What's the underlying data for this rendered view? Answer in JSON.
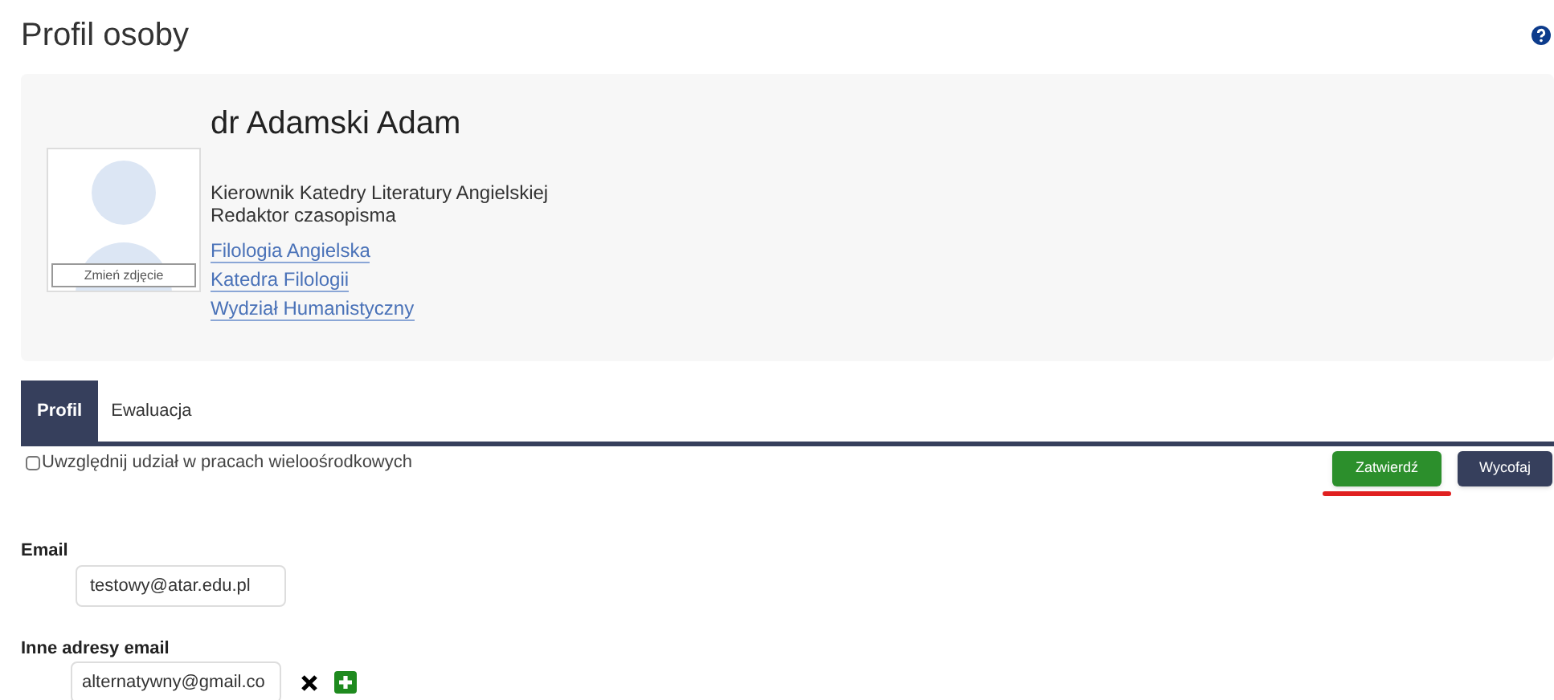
{
  "title": "Profil osoby",
  "profile": {
    "name": "dr Adamski Adam",
    "photo_button": "Zmień zdjęcie",
    "roles": [
      "Kierownik Katedry Literatury Angielskiej",
      "Redaktor czasopisma"
    ],
    "links": [
      "Filologia Angielska",
      "Katedra Filologii",
      "Wydział Humanistyczny"
    ]
  },
  "tabs": [
    {
      "label": "Profil",
      "selected": true
    },
    {
      "label": "Ewaluacja",
      "selected": false
    }
  ],
  "option": {
    "label": "Uwzględnij udział w pracach wieloośrodkowych",
    "checked": false
  },
  "buttons": [
    {
      "label": "Zatwierdź",
      "kind": "confirm",
      "highlighted": true
    },
    {
      "label": "Wycofaj",
      "kind": "cancel",
      "highlighted": false
    }
  ],
  "email": {
    "label": "Email",
    "value": "testowy@atar.edu.pl"
  },
  "other_emails": {
    "label": "Inne adresy email",
    "values": [
      "alternatywny@gmail.co"
    ]
  }
}
